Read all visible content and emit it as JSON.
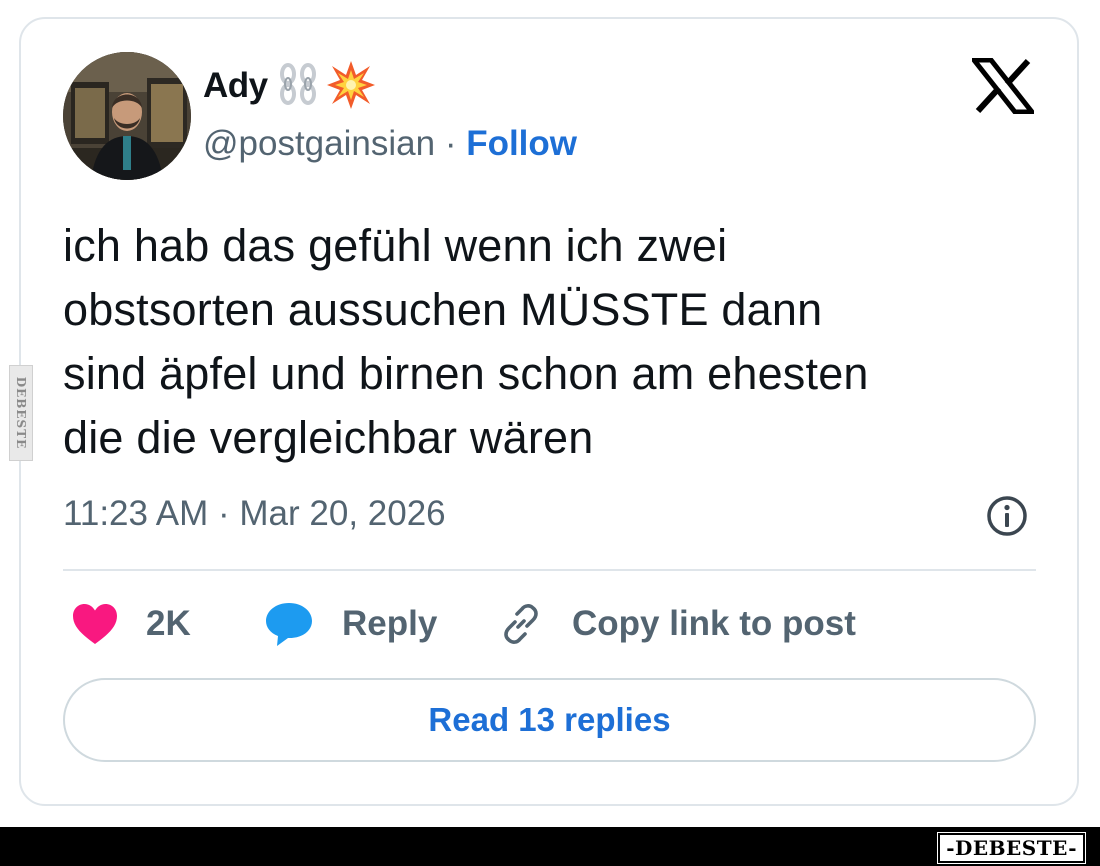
{
  "author": {
    "name": "Ady",
    "handle": "@postgainsian",
    "separator": "·",
    "follow_label": "Follow"
  },
  "tweet": {
    "lines": [
      "ich hab das gefühl wenn ich zwei",
      "obstsorten aussuchen MÜSSTE dann",
      "sind äpfel und birnen schon am ehesten",
      "die die vergleichbar wären"
    ],
    "timestamp": "11:23 AM · Mar 20, 2026"
  },
  "actions": {
    "likes_count": "2K",
    "reply_label": "Reply",
    "copy_link_label": "Copy link to post"
  },
  "read_replies_label": "Read 13 replies",
  "watermark": {
    "bottom": "-DEBESTE-",
    "side": "DEBESTE"
  },
  "colors": {
    "like": "#f91880",
    "reply": "#1d9bf0",
    "link_blue": "#1d6fd6",
    "muted": "#536471",
    "border": "#dfe5ea"
  },
  "icons": [
    "x-logo-icon",
    "info-icon",
    "heart-icon",
    "speech-bubble-icon",
    "link-icon",
    "chain-emoji-icon",
    "collision-emoji-icon"
  ]
}
